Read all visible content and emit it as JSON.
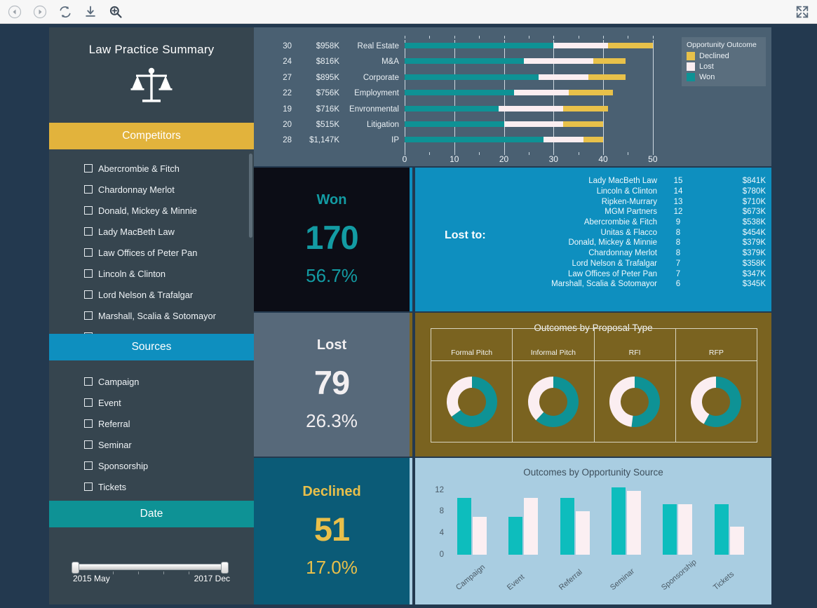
{
  "browser_toolbar": {
    "icons": [
      "back-icon",
      "forward-icon",
      "refresh-icon",
      "download-icon",
      "zoom-in-icon"
    ],
    "fullscreen_icon": "fullscreen-icon"
  },
  "sidebar": {
    "title": "Law Practice Summary",
    "logo_icon": "scales-of-justice-icon",
    "filters": [
      {
        "header": "Competitors",
        "header_color": "#e2b33c",
        "items": [
          "Abercrombie & Fitch",
          "Chardonnay Merlot",
          "Donald, Mickey & Minnie",
          "Lady MacBeth Law",
          "Law Offices of Peter Pan",
          "Lincoln & Clinton",
          "Lord Nelson & Trafalgar",
          "Marshall, Scalia & Sotomayor",
          "MGM Partners"
        ]
      },
      {
        "header": "Sources",
        "header_color": "#0e8fbf",
        "items": [
          "Campaign",
          "Event",
          "Referral",
          "Seminar",
          "Sponsorship",
          "Tickets"
        ]
      }
    ],
    "date_filter": {
      "header": "Date",
      "header_color": "#0e9295",
      "min_label": "2015 May",
      "max_label": "2017 Dec"
    }
  },
  "kpis": [
    {
      "title": "Won",
      "value": "170",
      "percent": "56.7%",
      "color": "#139ba3",
      "bg": "#0c0d16",
      "accent": "#0e8fbf"
    },
    {
      "title": "Lost",
      "value": "79",
      "percent": "26.3%",
      "color": "#f2eff1",
      "bg": "#57697a",
      "accent": "#7a6320"
    },
    {
      "title": "Declined",
      "value": "51",
      "percent": "17.0%",
      "color": "#e9bf4a",
      "bg": "#0b5b77",
      "accent": "#a9cde1"
    }
  ],
  "lost_to": {
    "label": "Lost to:",
    "rows": [
      {
        "name": "Lady MacBeth Law",
        "count": "15",
        "amount": "$841K"
      },
      {
        "name": "Lincoln & Clinton",
        "count": "14",
        "amount": "$780K"
      },
      {
        "name": "Ripken-Murrary",
        "count": "13",
        "amount": "$710K"
      },
      {
        "name": "MGM Partners",
        "count": "12",
        "amount": "$673K"
      },
      {
        "name": "Abercrombie & Fitch",
        "count": "9",
        "amount": "$538K"
      },
      {
        "name": "Unitas & Flacco",
        "count": "8",
        "amount": "$454K"
      },
      {
        "name": "Donald, Mickey & Minnie",
        "count": "8",
        "amount": "$379K"
      },
      {
        "name": "Chardonnay Merlot",
        "count": "8",
        "amount": "$379K"
      },
      {
        "name": "Lord Nelson & Trafalgar",
        "count": "7",
        "amount": "$358K"
      },
      {
        "name": "Law Offices of Peter Pan",
        "count": "7",
        "amount": "$347K"
      },
      {
        "name": "Marshall, Scalia & Sotomayor",
        "count": "6",
        "amount": "$345K"
      }
    ]
  },
  "chart_data": [
    {
      "id": "practice-area-outcomes",
      "type": "bar",
      "orientation": "horizontal",
      "stacked": true,
      "title": "",
      "xlabel": "",
      "ylabel": "",
      "xlim": [
        0,
        52
      ],
      "xticks": [
        0,
        10,
        20,
        30,
        40,
        50
      ],
      "grid": true,
      "legend": {
        "title": "Opportunity Outcome",
        "position": "top-right",
        "entries": [
          {
            "label": "Declined",
            "color": "#e8c14a"
          },
          {
            "label": "Lost",
            "color": "#fbeef1"
          },
          {
            "label": "Won",
            "color": "#0e9295"
          }
        ]
      },
      "row_labels": [
        "count",
        "value"
      ],
      "categories": [
        "Real Estate",
        "M&A",
        "Corporate",
        "Employment",
        "Envronmental",
        "Litigation",
        "IP"
      ],
      "counts": [
        "30",
        "24",
        "27",
        "22",
        "19",
        "20",
        "28"
      ],
      "amounts": [
        "$958K",
        "$816K",
        "$895K",
        "$756K",
        "$716K",
        "$515K",
        "$1,147K"
      ],
      "series": [
        {
          "name": "Won",
          "color": "#0e9295",
          "values": [
            30,
            24,
            27,
            22,
            19,
            20,
            28
          ]
        },
        {
          "name": "Lost",
          "color": "#fbeef1",
          "values": [
            11,
            14,
            10,
            11,
            13,
            12,
            8
          ]
        },
        {
          "name": "Declined",
          "color": "#e8c14a",
          "values": [
            9,
            6.5,
            7.5,
            9,
            9,
            8,
            4
          ]
        }
      ]
    },
    {
      "id": "outcomes-by-proposal-type",
      "type": "pie",
      "variant": "donut",
      "title": "Outcomes by Proposal Type",
      "legend": {
        "position": "none",
        "entries": [
          {
            "label": "Won",
            "color": "#0e9295"
          },
          {
            "label": "Lost",
            "color": "#fbeef1"
          }
        ]
      },
      "categories": [
        "Formal Pitch",
        "Informal Pitch",
        "RFI",
        "RFP"
      ],
      "donuts": [
        {
          "label": "Formal Pitch",
          "won_pct": 65,
          "lost_pct": 35
        },
        {
          "label": "Informal Pitch",
          "won_pct": 62,
          "lost_pct": 38
        },
        {
          "label": "RFI",
          "won_pct": 52,
          "lost_pct": 48
        },
        {
          "label": "RFP",
          "won_pct": 58,
          "lost_pct": 42
        }
      ]
    },
    {
      "id": "outcomes-by-opportunity-source",
      "type": "bar",
      "orientation": "vertical",
      "grouped": true,
      "title": "Outcomes by Opportunity Source",
      "xlabel": "",
      "ylabel": "",
      "ylim": [
        0,
        13
      ],
      "yticks": [
        0,
        4,
        8,
        12
      ],
      "grid": false,
      "categories": [
        "Campaign",
        "Event",
        "Referral",
        "Seminar",
        "Sponsorship",
        "Tickets"
      ],
      "series": [
        {
          "name": "Won",
          "color": "#0dbdbd",
          "values": [
            10.5,
            7.0,
            10.5,
            12.5,
            9.3,
            9.3
          ]
        },
        {
          "name": "Lost",
          "color": "#fbeff2",
          "values": [
            7.0,
            10.5,
            8.0,
            11.8,
            9.3,
            5.2
          ]
        }
      ]
    }
  ]
}
